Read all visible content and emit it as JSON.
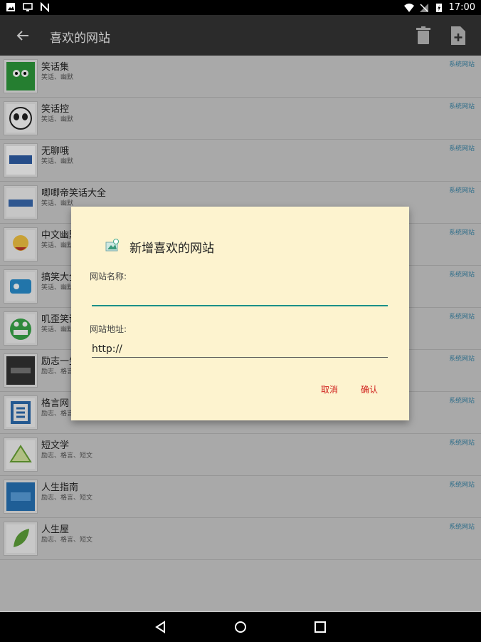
{
  "status_bar": {
    "time": "17:00"
  },
  "app_bar": {
    "title": "喜欢的网站"
  },
  "list": [
    {
      "name": "笑话集",
      "tags": "笑话、幽默",
      "badge": "系统网站",
      "thumb_color": "#2e9a3b"
    },
    {
      "name": "笑话控",
      "tags": "笑话、幽默",
      "badge": "系统网站",
      "thumb_color": "#222222"
    },
    {
      "name": "无聊哦",
      "tags": "笑话、幽默",
      "badge": "系统网站",
      "thumb_color": "#2f5fa8"
    },
    {
      "name": "唧唧帝笑话大全",
      "tags": "笑话、幽默",
      "badge": "系统网站",
      "thumb_color": "#3a6bb0"
    },
    {
      "name": "中文幽默",
      "tags": "笑话、幽默",
      "badge": "系统网站",
      "thumb_color": "#c0392b"
    },
    {
      "name": "搞笑大全",
      "tags": "笑话、幽默",
      "badge": "系统网站",
      "thumb_color": "#2a8fd0"
    },
    {
      "name": "叽歪笑话",
      "tags": "笑话、幽默",
      "badge": "系统网站",
      "thumb_color": "#3aa84a"
    },
    {
      "name": "励志一生",
      "tags": "励志、格言",
      "badge": "系统网站",
      "thumb_color": "#333333"
    },
    {
      "name": "格言网",
      "tags": "励志、格言",
      "badge": "系统网站",
      "thumb_color": "#2b6cb0"
    },
    {
      "name": "短文学",
      "tags": "励志、格言、短文",
      "badge": "系统网站",
      "thumb_color": "#6aa535"
    },
    {
      "name": "人生指南",
      "tags": "励志、格言、短文",
      "badge": "系统网站",
      "thumb_color": "#2673b8"
    },
    {
      "name": "人生屋",
      "tags": "励志、格言、短文",
      "badge": "系统网站",
      "thumb_color": "#5ea33a"
    }
  ],
  "dialog": {
    "title": "新增喜欢的网站",
    "name_label": "网站名称:",
    "name_value": "",
    "url_label": "网站地址:",
    "url_value": "http://",
    "cancel_label": "取消",
    "confirm_label": "确认"
  },
  "colors": {
    "app_bar_bg": "#2b2b2b",
    "dialog_bg": "#fdf3cf",
    "accent": "#1b8f88",
    "button_text": "#d0211d",
    "badge_text": "#3a86a8"
  }
}
